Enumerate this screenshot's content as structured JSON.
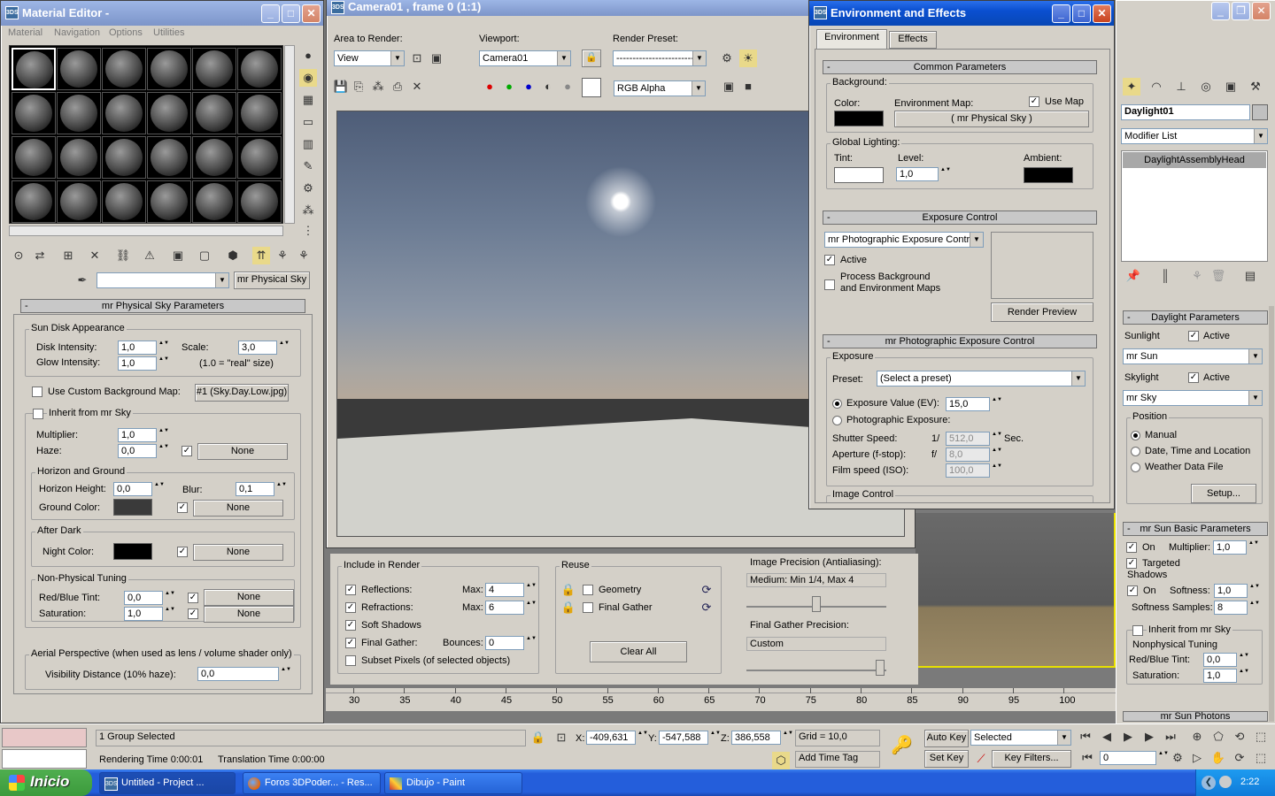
{
  "material_editor": {
    "title": "Material Editor -",
    "menu": [
      "Material",
      "Navigation",
      "Options",
      "Utilities"
    ],
    "material_name": "mr Physical Sky",
    "rollout": "mr Physical Sky Parameters",
    "sun_disk": {
      "title": "Sun Disk Appearance",
      "disk_label": "Disk Intensity:",
      "disk": "1,0",
      "glow_label": "Glow Intensity:",
      "glow": "1,0",
      "scale_label": "Scale:",
      "scale": "3,0",
      "note": "(1.0 = \"real\" size)"
    },
    "custom_bg": {
      "label": "Use Custom Background Map:",
      "map": "#1 (Sky.Day.Low.jpg)"
    },
    "inherit": "Inherit from mr Sky",
    "multiplier_label": "Multiplier:",
    "multiplier": "1,0",
    "haze_label": "Haze:",
    "haze": "0,0",
    "none": "None",
    "horizon": {
      "title": "Horizon and Ground",
      "height_label": "Horizon Height:",
      "height": "0,0",
      "blur_label": "Blur:",
      "blur": "0,1",
      "ground_label": "Ground Color:"
    },
    "after_dark": {
      "title": "After Dark",
      "night_label": "Night Color:"
    },
    "nonphys": {
      "title": "Non-Physical Tuning",
      "rb_label": "Red/Blue Tint:",
      "rb": "0,0",
      "sat_label": "Saturation:",
      "sat": "1,0"
    },
    "aerial": {
      "title": "Aerial Perspective (when used as lens / volume shader only)",
      "vis_label": "Visibility Distance (10% haze):",
      "vis": "0,0"
    }
  },
  "render": {
    "title": "Camera01 , frame 0 (1:1)",
    "area_label": "Area to Render:",
    "area": "View",
    "viewport_label": "Viewport:",
    "viewport": "Camera01",
    "preset_label": "Render Preset:",
    "preset": "-------------------------",
    "channel": "RGB Alpha"
  },
  "render_settings": {
    "include_title": "Include in Render",
    "reflections": "Reflections:",
    "refractions": "Refractions:",
    "soft_shadows": "Soft Shadows",
    "final_gather": "Final Gather:",
    "subset": "Subset Pixels (of selected objects)",
    "max_label": "Max:",
    "refl_max": "4",
    "refr_max": "6",
    "bounces_label": "Bounces:",
    "bounces": "0",
    "reuse_title": "Reuse",
    "geometry": "Geometry",
    "fg": "Final Gather",
    "clear_all": "Clear All",
    "precision_label": "Image Precision (Antialiasing):",
    "precision": "Medium: Min 1/4, Max 4",
    "fg_precision_label": "Final Gather Precision:",
    "fg_precision": "Custom"
  },
  "env": {
    "title": "Environment and Effects",
    "tabs": [
      "Environment",
      "Effects"
    ],
    "common": "Common Parameters",
    "background": "Background:",
    "color": "Color:",
    "env_map": "Environment Map:",
    "use_map": "Use Map",
    "map_name": "( mr Physical Sky )",
    "global": "Global Lighting:",
    "tint": "Tint:",
    "level_label": "Level:",
    "level": "1,0",
    "ambient": "Ambient:",
    "exposure_control": "Exposure Control",
    "exposure_type": "mr Photographic Exposure Contro",
    "active": "Active",
    "process": "Process Background and Environment Maps",
    "render_preview": "Render Preview",
    "mr_photo": "mr Photographic Exposure Control",
    "exposure": "Exposure",
    "preset_label": "Preset:",
    "preset": "(Select a preset)",
    "ev_label": "Exposure Value (EV):",
    "ev": "15,0",
    "photo_exposure": "Photographic Exposure:",
    "shutter_label": "Shutter Speed:",
    "shutter_pre": "1/",
    "shutter": "512,0",
    "sec": "Sec.",
    "aperture_label": "Aperture (f-stop):",
    "aperture_pre": "f/",
    "aperture": "8,0",
    "film_label": "Film speed (ISO):",
    "film": "100,0",
    "image_control": "Image Control"
  },
  "cmd": {
    "object": "Daylight01",
    "modifier_list": "Modifier List",
    "stack_item": "DaylightAssemblyHead",
    "daylight_params": "Daylight Parameters",
    "sunlight": "Sunlight",
    "active": "Active",
    "sun": "mr Sun",
    "skylight": "Skylight",
    "sky": "mr Sky",
    "position": "Position",
    "manual": "Manual",
    "datetime": "Date, Time and Location",
    "weather": "Weather Data File",
    "setup": "Setup...",
    "sun_basic": "mr Sun Basic Parameters",
    "on": "On",
    "multiplier_label": "Multiplier:",
    "multiplier": "1,0",
    "targeted": "Targeted",
    "shadows": "Shadows",
    "softness_label": "Softness:",
    "softness": "1,0",
    "samples_label": "Softness Samples:",
    "samples": "8",
    "inherit": "Inherit from mr Sky",
    "nonphys": "Nonphysical Tuning",
    "rb_label": "Red/Blue Tint:",
    "rb": "0,0",
    "sat_label": "Saturation:",
    "sat": "1,0",
    "photons": "mr Sun Photons"
  },
  "timeline": [
    "30",
    "35",
    "40",
    "45",
    "50",
    "55",
    "60",
    "65",
    "70",
    "75",
    "80",
    "85",
    "90",
    "95",
    "100"
  ],
  "status": {
    "selection": "1 Group Selected",
    "rendering": "Rendering Time  0:00:01",
    "translation": "Translation Time  0:00:00",
    "x": "-409,631",
    "y": "-547,588",
    "z": "386,558",
    "grid": "Grid = 10,0",
    "add_tag": "Add Time Tag",
    "auto_key": "Auto Key",
    "set_key": "Set Key",
    "selected": "Selected",
    "key_filters": "Key Filters...",
    "frame": "0"
  },
  "taskbar": {
    "start": "Inicio",
    "items": [
      "Untitled      - Project ...",
      "Foros 3DPoder... - Res...",
      "Dibujo - Paint"
    ],
    "clock": "2:22"
  },
  "colors": {
    "xp_blue": "#0a4fd0",
    "start_green": "#3c9a3c"
  }
}
